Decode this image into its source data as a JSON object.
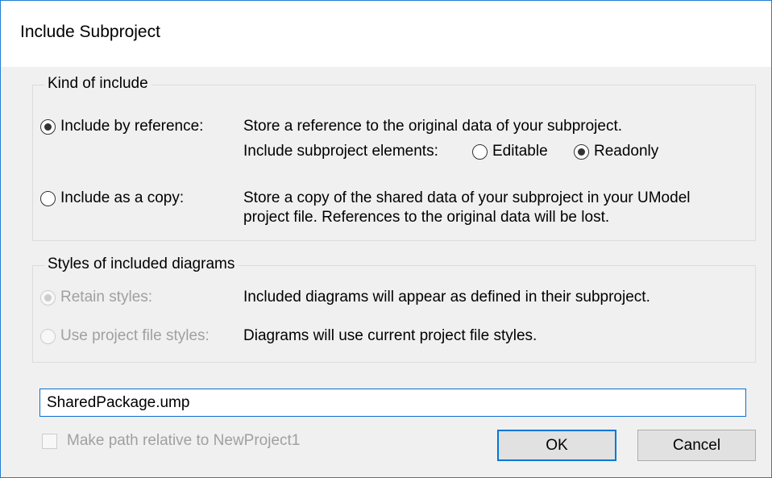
{
  "dialog": {
    "title": "Include Subproject"
  },
  "kind_group": {
    "legend": "Kind of include",
    "by_reference": {
      "label": "Include by reference:",
      "checked": true,
      "description": "Store a reference to the original data of your subproject.",
      "elements_label": "Include subproject elements:",
      "editable_label": "Editable",
      "editable_checked": false,
      "readonly_label": "Readonly",
      "readonly_checked": true
    },
    "as_copy": {
      "label": "Include as a copy:",
      "checked": false,
      "description_line1": "Store a copy of the shared data of your subproject in your UModel",
      "description_line2": "project file. References to the original data will be lost."
    }
  },
  "styles_group": {
    "legend": "Styles of included diagrams",
    "retain": {
      "label": "Retain styles:",
      "checked": true,
      "disabled": true,
      "description": "Included diagrams will appear as defined in their subproject."
    },
    "project_file": {
      "label": "Use project file styles:",
      "checked": false,
      "disabled": true,
      "description": "Diagrams will use current project file styles."
    }
  },
  "path_input": {
    "value": "SharedPackage.ump"
  },
  "relative_checkbox": {
    "label": "Make path relative to NewProject1",
    "checked": false,
    "disabled": true
  },
  "buttons": {
    "ok": "OK",
    "cancel": "Cancel"
  },
  "colors": {
    "accent": "#0078d7",
    "disabled_text": "#a0a0a0",
    "dialog_background": "#f0f0f0"
  }
}
